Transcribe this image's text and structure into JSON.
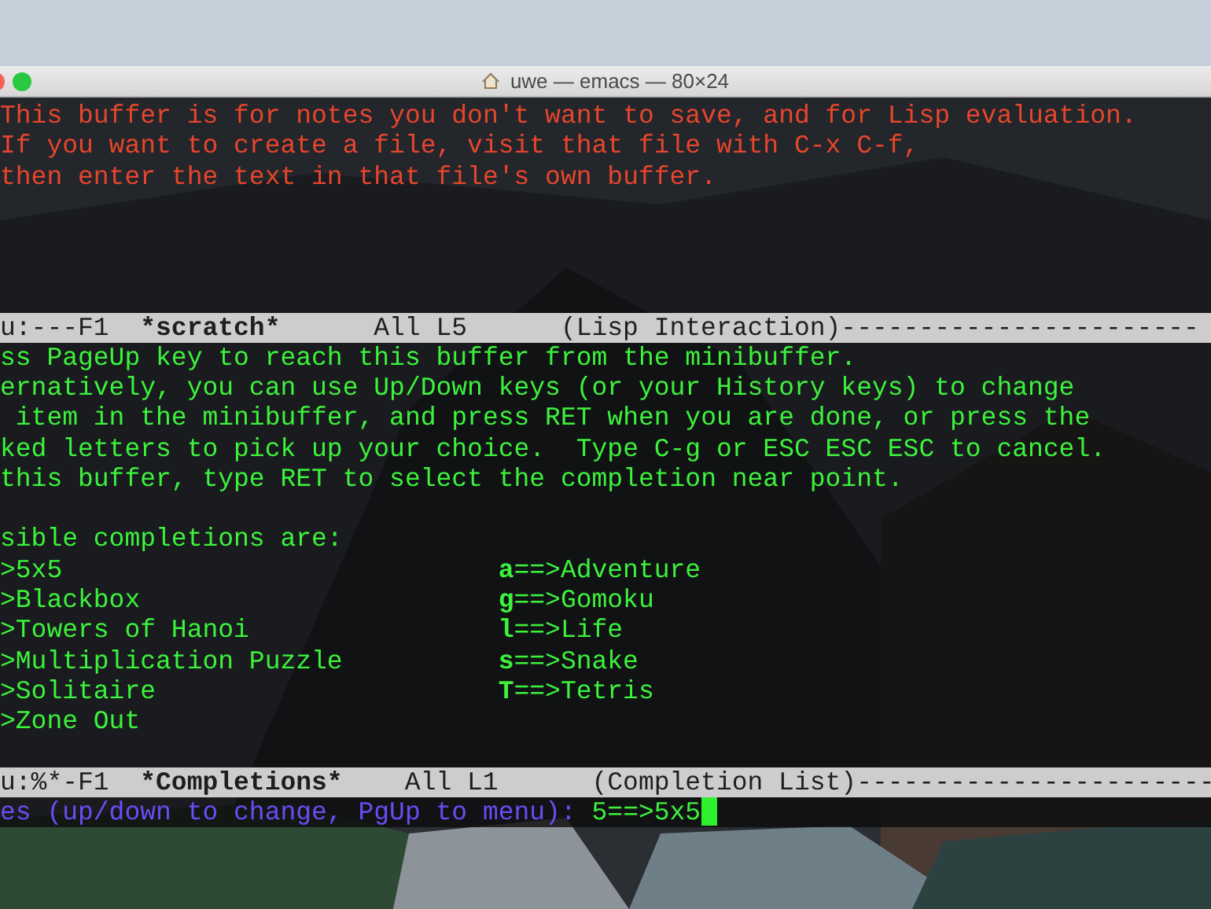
{
  "window": {
    "title": "uwe — emacs — 80×24"
  },
  "scratch_buffer": {
    "lines": [
      "This buffer is for notes you don't want to save, and for Lisp evaluation.",
      "If you want to create a file, visit that file with C-x C-f,",
      "then enter the text in that file's own buffer."
    ]
  },
  "mode_lines": [
    {
      "status": "u:---F1",
      "buffer": "*scratch*",
      "position": "All L5",
      "mode": "(Lisp Interaction)",
      "fill": "-----------------------"
    },
    {
      "status": "u:%*-F1",
      "buffer": "*Completions*",
      "position": "All L1",
      "mode": "(Completion List)",
      "fill": "-----------------------"
    }
  ],
  "completions_buffer": {
    "help_lines": [
      "ss PageUp key to reach this buffer from the minibuffer.",
      "ernatively, you can use Up/Down keys (or your History keys) to change",
      " item in the minibuffer, and press RET when you are done, or press the",
      "ked letters to pick up your choice.  Type C-g or ESC ESC ESC to cancel.",
      "this buffer, type RET to select the completion near point."
    ],
    "heading": "sible completions are:",
    "rows": [
      {
        "left": ">5x5",
        "right": "**a**==>Adventure"
      },
      {
        "left": ">Blackbox",
        "right": "**g**==>Gomoku"
      },
      {
        "left": ">Towers of Hanoi",
        "right": "**l**==>Life"
      },
      {
        "left": ">Multiplication Puzzle",
        "right": "**s**==>Snake"
      },
      {
        "left": ">Solitaire",
        "right": "**T**==>Tetris"
      },
      {
        "left": ">Zone Out"
      }
    ]
  },
  "minibuffer": {
    "prompt": "es (up/down to change, PgUp to menu): ",
    "value": "5==>5x5",
    "cursor_visible": true
  }
}
